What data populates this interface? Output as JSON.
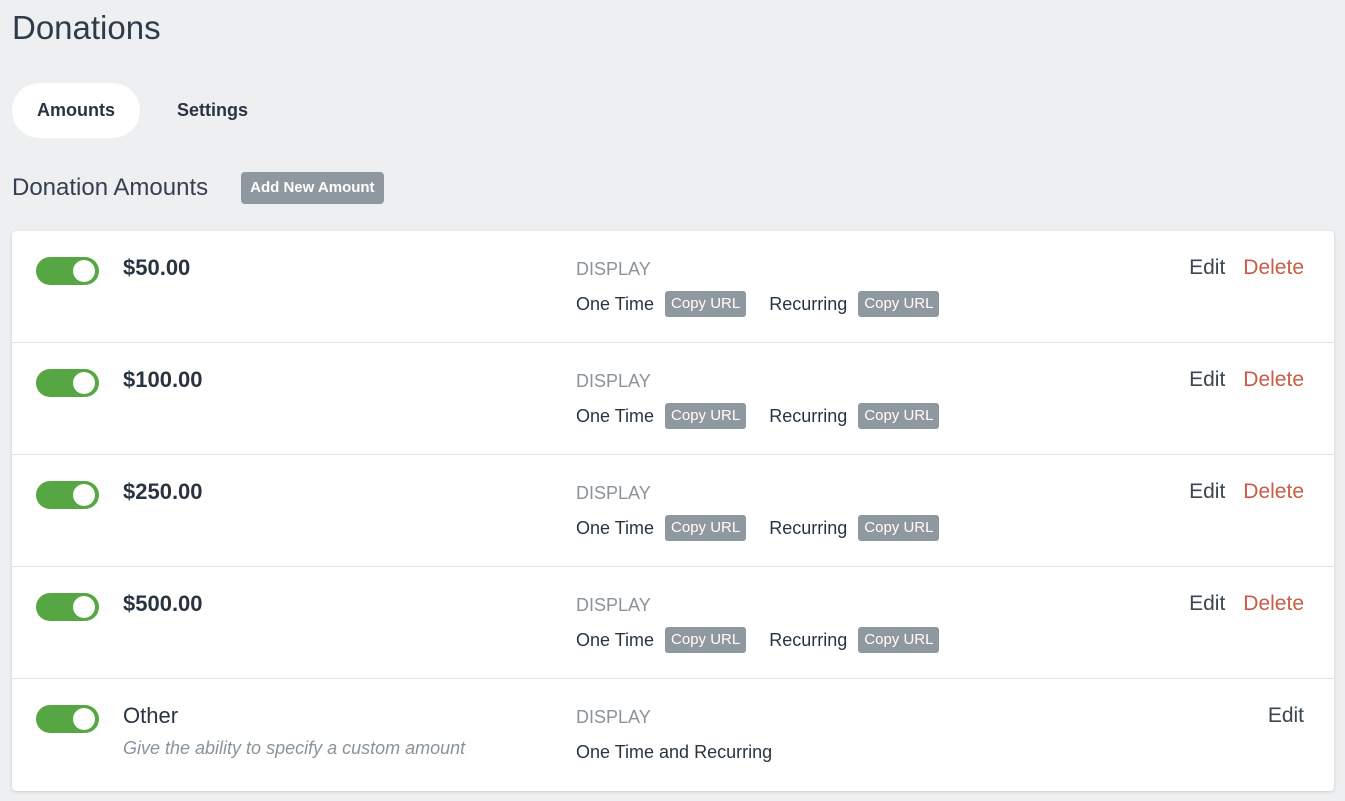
{
  "page": {
    "title": "Donations"
  },
  "tabs": [
    {
      "label": "Amounts",
      "active": true
    },
    {
      "label": "Settings",
      "active": false
    }
  ],
  "section": {
    "title": "Donation Amounts",
    "add_button": "Add New Amount"
  },
  "rows": [
    {
      "amount": "$50.00",
      "enabled": true,
      "display_label": "DISPLAY",
      "one_time_label": "One Time",
      "one_time_button": "Copy URL",
      "recurring_label": "Recurring",
      "recurring_button": "Copy URL",
      "edit": "Edit",
      "delete": "Delete"
    },
    {
      "amount": "$100.00",
      "enabled": true,
      "display_label": "DISPLAY",
      "one_time_label": "One Time",
      "one_time_button": "Copy URL",
      "recurring_label": "Recurring",
      "recurring_button": "Copy URL",
      "edit": "Edit",
      "delete": "Delete"
    },
    {
      "amount": "$250.00",
      "enabled": true,
      "display_label": "DISPLAY",
      "one_time_label": "One Time",
      "one_time_button": "Copy URL",
      "recurring_label": "Recurring",
      "recurring_button": "Copy URL",
      "edit": "Edit",
      "delete": "Delete"
    },
    {
      "amount": "$500.00",
      "enabled": true,
      "display_label": "DISPLAY",
      "one_time_label": "One Time",
      "one_time_button": "Copy URL",
      "recurring_label": "Recurring",
      "recurring_button": "Copy URL",
      "edit": "Edit",
      "delete": "Delete"
    }
  ],
  "other_row": {
    "label": "Other",
    "enabled": true,
    "description": "Give the ability to specify a custom amount",
    "display_label": "DISPLAY",
    "display_value": "One Time and Recurring",
    "edit": "Edit"
  },
  "colors": {
    "background": "#edeff1",
    "toggle_on": "#57a644",
    "delete": "#c95c47",
    "button_gray": "#8f989f"
  }
}
